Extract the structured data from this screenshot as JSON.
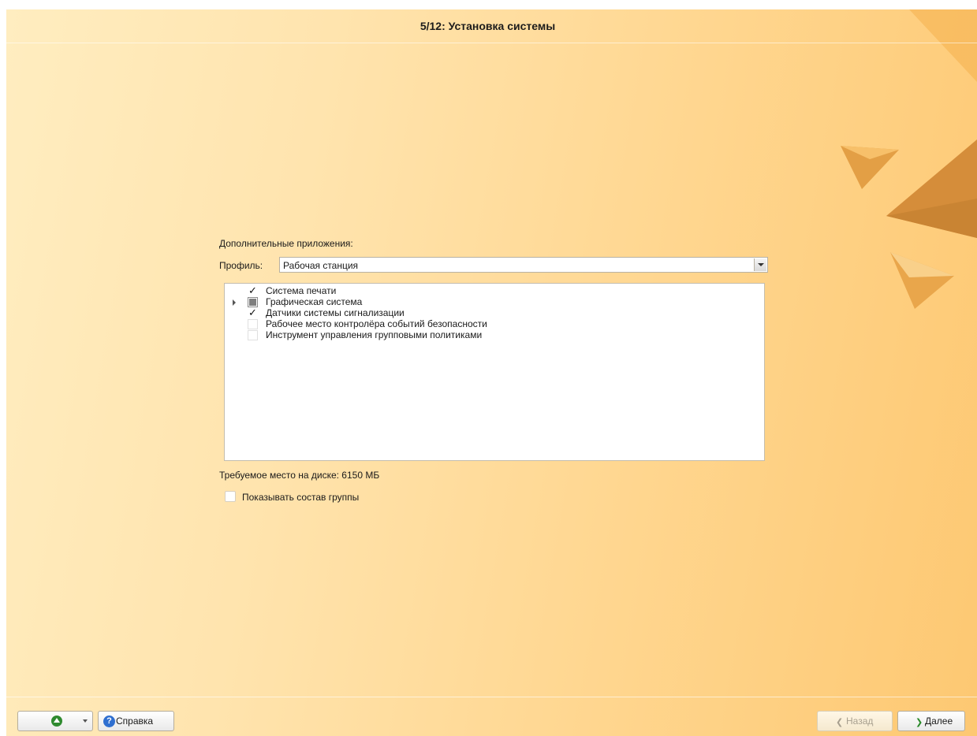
{
  "header": {
    "title": "5/12: Установка системы"
  },
  "main": {
    "apps_label": "Дополнительные приложения:",
    "profile": {
      "label": "Профиль:",
      "value": "Рабочая станция"
    },
    "tree_items": [
      {
        "label": "Система печати",
        "state": "checked",
        "mark": "✓",
        "expandable": false
      },
      {
        "label": "Графическая система",
        "state": "partial",
        "mark": "",
        "expandable": true
      },
      {
        "label": "Датчики системы сигнализации",
        "state": "checked",
        "mark": "✓",
        "expandable": false
      },
      {
        "label": "Рабочее место контролёра событий безопасности",
        "state": "unchecked",
        "mark": "",
        "expandable": false
      },
      {
        "label": "Инструмент управления групповыми политиками",
        "state": "unchecked",
        "mark": "",
        "expandable": false
      }
    ],
    "disk_space": "Требуемое место на диске: 6150 МБ",
    "show_group": {
      "label": "Показывать состав группы",
      "checked": false
    }
  },
  "footer": {
    "help_label": "Справка",
    "help_icon": "?",
    "back_label": "Назад",
    "back_arrow": "❮",
    "next_label": "Далее",
    "next_arrow": "❯"
  },
  "colors": {
    "background_start": "#ffedc0",
    "background_end": "#fdc872",
    "accent_green": "#2f8a2f",
    "help_blue": "#2f6fd0"
  },
  "icons": {
    "menu_button": "green-up-arrow-icon",
    "help_button": "question-mark-icon"
  }
}
